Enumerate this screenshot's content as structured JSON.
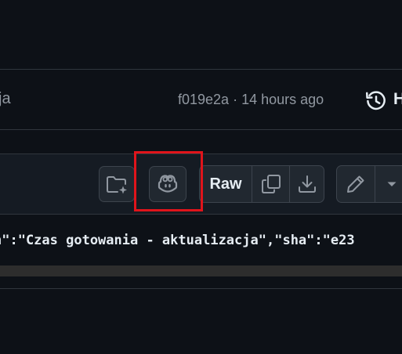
{
  "commit": {
    "message_fragment": "ja",
    "sha": "f019e2a",
    "separator": "·",
    "time": "14 hours ago",
    "history_label": "H"
  },
  "toolbar": {
    "raw_label": "Raw"
  },
  "code": {
    "line": "n\":\"Czas gotowania - aktualizacja\",\"sha\":\"e23"
  },
  "icons": {
    "history": "history-icon",
    "folder_sparkle": "folder-sparkle-icon",
    "copilot": "copilot-icon",
    "copy": "copy-icon",
    "download": "download-icon",
    "pencil": "pencil-icon",
    "caret": "caret-down-icon"
  },
  "colors": {
    "background": "#0d1117",
    "toolbar_background": "#151b23",
    "button_background": "#212830",
    "border": "#30363d",
    "muted_text": "#9198a1",
    "text": "#e6edf3",
    "highlight": "#e0141b"
  }
}
